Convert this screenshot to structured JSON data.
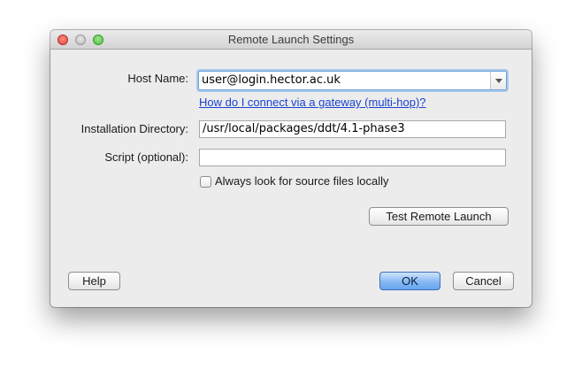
{
  "window": {
    "title": "Remote Launch Settings"
  },
  "form": {
    "host_label": "Host Name:",
    "host_value": "user@login.hector.ac.uk",
    "gateway_link": "How do I connect via a gateway (multi-hop)?",
    "install_label": "Installation Directory:",
    "install_value": "/usr/local/packages/ddt/4.1-phase3",
    "script_label": "Script (optional):",
    "script_value": "",
    "local_files_checkbox_label": "Always look for source files locally",
    "local_files_checked": false
  },
  "buttons": {
    "test_remote_launch": "Test Remote Launch",
    "help": "Help",
    "ok": "OK",
    "cancel": "Cancel"
  },
  "colors": {
    "link": "#1a43d1",
    "focus_ring": "#a9c9ee",
    "default_button": "#68a5f0"
  }
}
